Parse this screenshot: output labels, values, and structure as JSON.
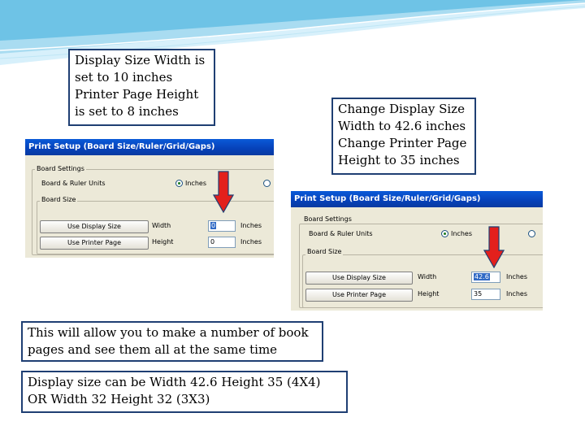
{
  "callouts": {
    "top_left": {
      "lines": [
        "Display Size Width is",
        "set to 10 inches",
        "Printer Page Height",
        "is set to 8 inches"
      ]
    },
    "top_right": {
      "lines": [
        "Change Display Size",
        "Width to 42.6 inches",
        "Change Printer Page",
        "Height to 35 inches"
      ]
    },
    "middle": {
      "lines": [
        "This will allow you to make a number of book",
        "pages and see them all at the same time"
      ]
    },
    "bottom": {
      "lines": [
        "Display size can be Width 42.6  Height 35 (4X4)",
        "OR Width 32   Height 32 (3X3)"
      ]
    }
  },
  "dialog_before": {
    "title": "Print Setup (Board Size/Ruler/Grid/Gaps)",
    "board_settings_label": "Board Settings",
    "board_ruler_units_label": "Board & Ruler Units",
    "inches_option": "Inches",
    "board_size_label": "Board Size",
    "use_display_size_button": "Use Display Size",
    "use_printer_page_button": "Use Printer Page",
    "width_label": "Width",
    "height_label": "Height",
    "width_value": "0",
    "height_value": "0",
    "width_units": "Inches",
    "height_units": "Inches"
  },
  "dialog_after": {
    "title": "Print Setup (Board Size/Ruler/Grid/Gaps)",
    "board_settings_label": "Board Settings",
    "board_ruler_units_label": "Board & Ruler Units",
    "inches_option": "Inches",
    "board_size_label": "Board Size",
    "use_display_size_button": "Use Display Size",
    "use_printer_page_button": "Use Printer Page",
    "width_label": "Width",
    "height_label": "Height",
    "width_value": "42.6",
    "height_value": "35",
    "width_units": "Inches",
    "height_units": "Inches"
  },
  "colors": {
    "titlebar": "#0641b8",
    "callout_border": "#1f3f73",
    "arrow_fill": "#e3201c",
    "arrow_outline": "#1f3f73",
    "wave": "#6ec3e6"
  }
}
